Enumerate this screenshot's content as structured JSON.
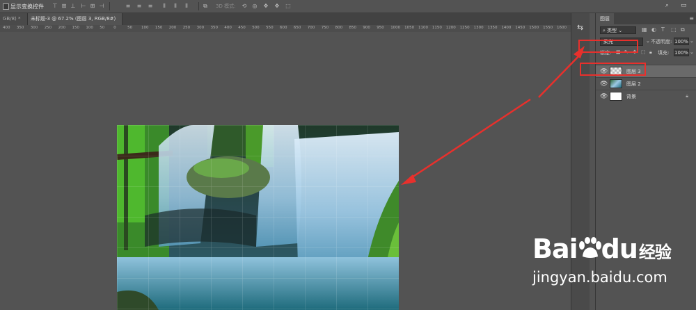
{
  "options_bar": {
    "show_transform_controls_label": "显示变换控件",
    "mode_3d_label": "3D 模式:"
  },
  "tabs": [
    {
      "label": "GB/8) *",
      "active": false
    },
    {
      "label": "未标题-3 @ 67.2% (图层 3, RGB/8#) *",
      "active": true
    }
  ],
  "ruler": {
    "ticks": [
      "400",
      "350",
      "300",
      "250",
      "200",
      "150",
      "100",
      "50",
      "0",
      "50",
      "100",
      "150",
      "200",
      "250",
      "300",
      "350",
      "400",
      "450",
      "500",
      "550",
      "600",
      "650",
      "700",
      "750",
      "800",
      "850",
      "900",
      "950",
      "1000",
      "1050",
      "1100",
      "1150",
      "1200",
      "1250",
      "1300",
      "1350",
      "1400",
      "1450",
      "1500",
      "1550",
      "1600"
    ]
  },
  "layers_panel": {
    "tab_label": "图层",
    "filter_kind": "类型",
    "blend_mode": "柔光",
    "opacity_label": "不透明度:",
    "opacity_value": "100%",
    "lock_label": "锁定:",
    "fill_label": "填充:",
    "fill_value": "100%",
    "layers": [
      {
        "name": "图层 3",
        "selected": true,
        "locked": false
      },
      {
        "name": "图层 2",
        "selected": false,
        "locked": false
      },
      {
        "name": "背景",
        "selected": false,
        "locked": true
      }
    ]
  },
  "annotation_color": "#e8302c",
  "watermark": {
    "brand": "Bai",
    "brand2": "du",
    "brand_cn": "经验",
    "url": "jingyan.baidu.com"
  }
}
